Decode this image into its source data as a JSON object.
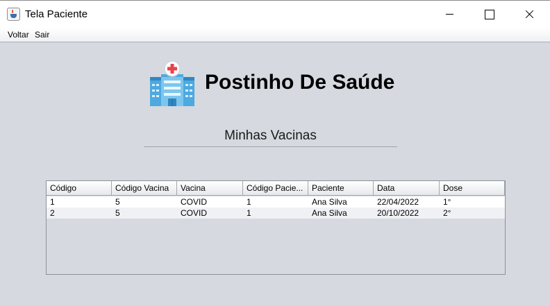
{
  "window": {
    "title": "Tela Paciente"
  },
  "menu": {
    "items": [
      "Voltar",
      "Sair"
    ]
  },
  "brand": {
    "name": "Postinho De Saúde",
    "logo_icon": "hospital-building-icon"
  },
  "section": {
    "title": "Minhas Vacinas"
  },
  "table": {
    "columns": [
      "Código",
      "Código Vacina",
      "Vacina",
      "Código Pacie...",
      "Paciente",
      "Data",
      "Dose"
    ],
    "rows": [
      [
        "1",
        "5",
        "COVID",
        "1",
        "Ana Silva",
        "22/04/2022",
        "1°"
      ],
      [
        "2",
        "5",
        "COVID",
        "1",
        "Ana Silva",
        "20/10/2022",
        "2°"
      ]
    ]
  },
  "colors": {
    "background": "#d6d9df",
    "cross_red": "#e8434a",
    "building_blue": "#5ab4e8"
  }
}
